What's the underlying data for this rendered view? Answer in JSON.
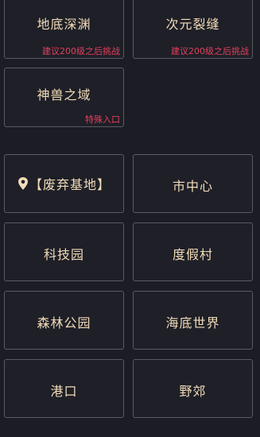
{
  "dungeons": [
    {
      "title": "地底深渊",
      "note": "建议200级之后挑战"
    },
    {
      "title": "次元裂缝",
      "note": "建议200级之后挑战"
    },
    {
      "title": "神兽之域",
      "note": "特殊入口"
    }
  ],
  "locations": {
    "current_marker_icon": "location-pin-icon",
    "current": "【废弃基地】",
    "items": [
      "市中心",
      "科技园",
      "度假村",
      "森林公园",
      "海底世界",
      "港口",
      "野郊"
    ]
  }
}
